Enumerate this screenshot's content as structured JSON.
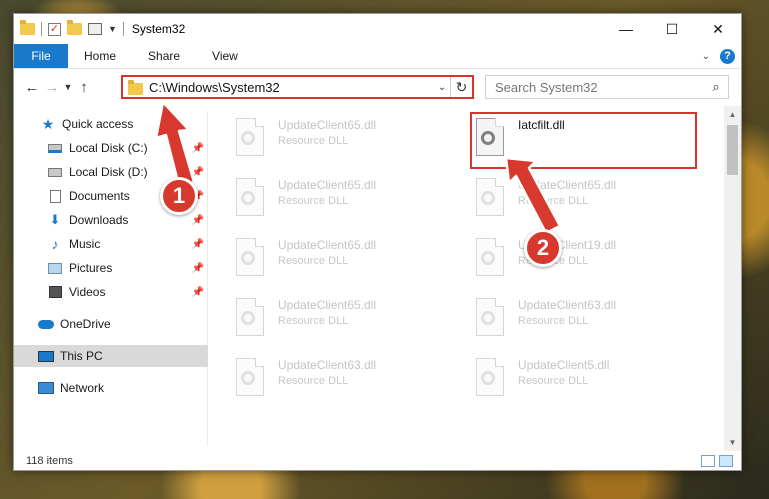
{
  "window": {
    "title": "System32",
    "controls": {
      "minimize": "—",
      "maximize": "☐",
      "close": "✕"
    }
  },
  "ribbon": {
    "tabs": [
      "File",
      "Home",
      "Share",
      "View"
    ],
    "help": "?"
  },
  "address": {
    "path": "C:\\Windows\\System32",
    "search_placeholder": "Search System32"
  },
  "nav": {
    "items": [
      {
        "label": "Quick access",
        "icon": "star-icon"
      },
      {
        "label": "Local Disk (C:)",
        "icon": "drive-icon",
        "pinned": true
      },
      {
        "label": "Local Disk (D:)",
        "icon": "drive-icon",
        "pinned": true
      },
      {
        "label": "Documents",
        "icon": "documents-icon",
        "pinned": true
      },
      {
        "label": "Downloads",
        "icon": "downloads-icon",
        "pinned": true
      },
      {
        "label": "Music",
        "icon": "music-icon",
        "pinned": true
      },
      {
        "label": "Pictures",
        "icon": "pictures-icon",
        "pinned": true
      },
      {
        "label": "Videos",
        "icon": "videos-icon",
        "pinned": true
      },
      {
        "label": "OneDrive",
        "icon": "cloud-icon"
      },
      {
        "label": "This PC",
        "icon": "computer-icon",
        "selected": true
      },
      {
        "label": "Network",
        "icon": "network-icon"
      }
    ]
  },
  "files": {
    "left": [
      {
        "name": "UpdateClient65.dll",
        "type": "Resource DLL"
      },
      {
        "name": "UpdateClient65.dll",
        "type": "Resource DLL"
      },
      {
        "name": "UpdateClient65.dll",
        "type": "Resource DLL"
      },
      {
        "name": "UpdateClient65.dll",
        "type": "Resource DLL"
      },
      {
        "name": "UpdateClient63.dll",
        "type": "Resource DLL"
      }
    ],
    "right": [
      {
        "name": "Iatcfilt.dll",
        "type": ""
      },
      {
        "name": "UpdateClient65.dll",
        "type": "Resource DLL"
      },
      {
        "name": "UpdateClient19.dll",
        "type": "Resource DLL"
      },
      {
        "name": "UpdateClient63.dll",
        "type": "Resource DLL"
      },
      {
        "name": "UpdateClient5.dll",
        "type": "Resource DLL"
      }
    ]
  },
  "status": {
    "item_count": "118 items"
  },
  "annotations": {
    "marker1": "1",
    "marker2": "2",
    "color": "#d7392e"
  },
  "colors": {
    "accent": "#1979ca",
    "highlight": "#d9342b",
    "selection": "#cce8ff"
  }
}
